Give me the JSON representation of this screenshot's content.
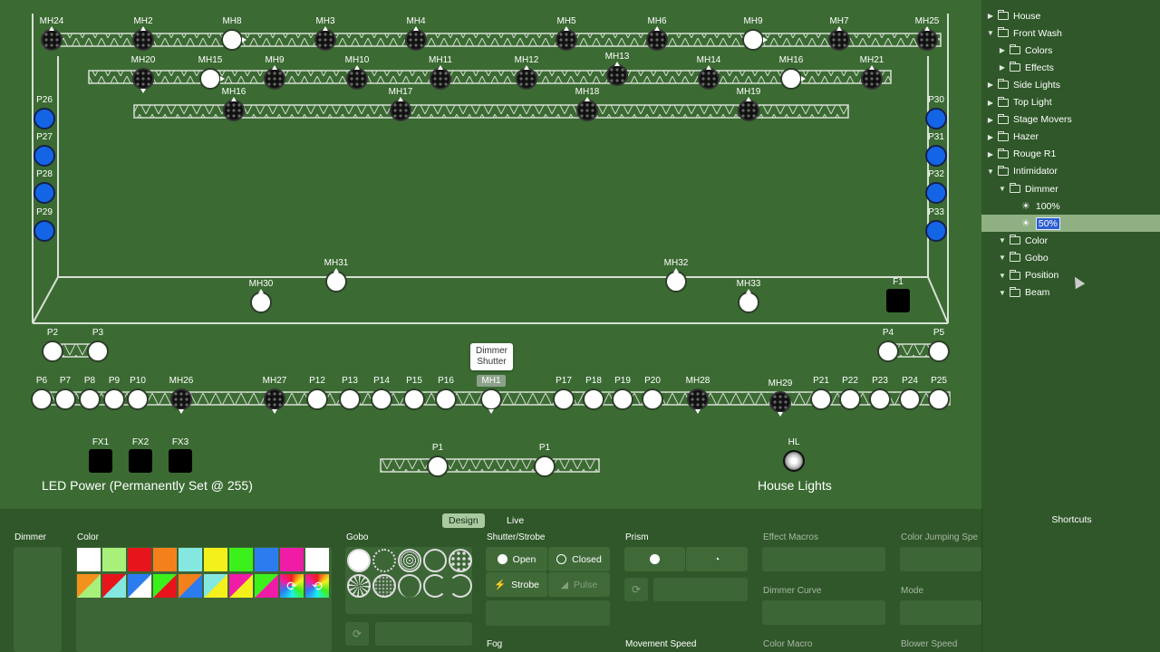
{
  "stage": {
    "fixtures": [
      {
        "id": "MH24",
        "label": "MH24",
        "style": "dark",
        "pointer": "up"
      },
      {
        "id": "MH2",
        "label": "MH2",
        "style": "dark",
        "pointer": "up"
      },
      {
        "id": "MH8",
        "label": "MH8",
        "style": "white",
        "pointer": "right"
      },
      {
        "id": "MH3",
        "label": "MH3",
        "style": "dark",
        "pointer": "up"
      },
      {
        "id": "MH4",
        "label": "MH4",
        "style": "dark",
        "pointer": "up"
      },
      {
        "id": "MH5",
        "label": "MH5",
        "style": "dark",
        "pointer": "up"
      },
      {
        "id": "MH6",
        "label": "MH6",
        "style": "dark",
        "pointer": "up"
      },
      {
        "id": "MH9a",
        "label": "MH9",
        "style": "white",
        "pointer": "right"
      },
      {
        "id": "MH7",
        "label": "MH7",
        "style": "dark",
        "pointer": "up"
      },
      {
        "id": "MH25",
        "label": "MH25",
        "style": "dark",
        "pointer": "up"
      },
      {
        "id": "MH20",
        "label": "MH20",
        "style": "dark",
        "pointer": "down"
      },
      {
        "id": "MH15",
        "label": "MH15",
        "style": "white",
        "pointer": "right"
      },
      {
        "id": "MH9b",
        "label": "MH9",
        "style": "dark",
        "pointer": "up"
      },
      {
        "id": "MH10",
        "label": "MH10",
        "style": "dark",
        "pointer": "up"
      },
      {
        "id": "MH11",
        "label": "MH11",
        "style": "dark",
        "pointer": "up"
      },
      {
        "id": "MH12",
        "label": "MH12",
        "style": "dark",
        "pointer": "up"
      },
      {
        "id": "MH13",
        "label": "MH13",
        "style": "dark",
        "pointer": "up"
      },
      {
        "id": "MH14",
        "label": "MH14",
        "style": "dark",
        "pointer": "up"
      },
      {
        "id": "MH16",
        "label": "MH16",
        "style": "white",
        "pointer": "right"
      },
      {
        "id": "MH21",
        "label": "MH21",
        "style": "dark",
        "pointer": "up"
      },
      {
        "id": "MH16b",
        "label": "MH16",
        "style": "dark",
        "pointer": "up"
      },
      {
        "id": "MH17",
        "label": "MH17",
        "style": "dark",
        "pointer": "up"
      },
      {
        "id": "MH18",
        "label": "MH18",
        "style": "dark",
        "pointer": "up"
      },
      {
        "id": "MH19",
        "label": "MH19",
        "style": "dark",
        "pointer": "up"
      },
      {
        "id": "P26",
        "label": "P26",
        "style": "blue"
      },
      {
        "id": "P27",
        "label": "P27",
        "style": "blue"
      },
      {
        "id": "P28",
        "label": "P28",
        "style": "blue"
      },
      {
        "id": "P29",
        "label": "P29",
        "style": "blue"
      },
      {
        "id": "P30",
        "label": "P30",
        "style": "blue"
      },
      {
        "id": "P31",
        "label": "P31",
        "style": "blue"
      },
      {
        "id": "P32",
        "label": "P32",
        "style": "blue"
      },
      {
        "id": "P33",
        "label": "P33",
        "style": "blue"
      },
      {
        "id": "MH31",
        "label": "MH31",
        "style": "white",
        "pointer": "up"
      },
      {
        "id": "MH32",
        "label": "MH32",
        "style": "white",
        "pointer": "up"
      },
      {
        "id": "MH30",
        "label": "MH30",
        "style": "white",
        "pointer": "up"
      },
      {
        "id": "MH33",
        "label": "MH33",
        "style": "white",
        "pointer": "up"
      },
      {
        "id": "F1",
        "label": "F1",
        "style": "square"
      },
      {
        "id": "P2",
        "label": "P2",
        "style": "white"
      },
      {
        "id": "P3",
        "label": "P3",
        "style": "white"
      },
      {
        "id": "P4",
        "label": "P4",
        "style": "white"
      },
      {
        "id": "P5",
        "label": "P5",
        "style": "white"
      },
      {
        "id": "P6",
        "label": "P6",
        "style": "white"
      },
      {
        "id": "P7",
        "label": "P7",
        "style": "white"
      },
      {
        "id": "P8",
        "label": "P8",
        "style": "white"
      },
      {
        "id": "P9",
        "label": "P9",
        "style": "white"
      },
      {
        "id": "P10",
        "label": "P10",
        "style": "white"
      },
      {
        "id": "MH26",
        "label": "MH26",
        "style": "dark",
        "pointer": "down"
      },
      {
        "id": "MH27",
        "label": "MH27",
        "style": "dark",
        "pointer": "down"
      },
      {
        "id": "P12",
        "label": "P12",
        "style": "white"
      },
      {
        "id": "P13",
        "label": "P13",
        "style": "white"
      },
      {
        "id": "P14",
        "label": "P14",
        "style": "white"
      },
      {
        "id": "P15",
        "label": "P15",
        "style": "white"
      },
      {
        "id": "P16",
        "label": "P16",
        "style": "white"
      },
      {
        "id": "MH1",
        "label": "MH1",
        "style": "white",
        "pointer": "down",
        "selected": true
      },
      {
        "id": "P17",
        "label": "P17",
        "style": "white"
      },
      {
        "id": "P18",
        "label": "P18",
        "style": "white"
      },
      {
        "id": "P19",
        "label": "P19",
        "style": "white"
      },
      {
        "id": "P20",
        "label": "P20",
        "style": "white"
      },
      {
        "id": "MH28",
        "label": "MH28",
        "style": "dark",
        "pointer": "down"
      },
      {
        "id": "MH29",
        "label": "MH29",
        "style": "dark",
        "pointer": "down"
      },
      {
        "id": "P21",
        "label": "P21",
        "style": "white"
      },
      {
        "id": "P22",
        "label": "P22",
        "style": "white"
      },
      {
        "id": "P23",
        "label": "P23",
        "style": "white"
      },
      {
        "id": "P24",
        "label": "P24",
        "style": "white"
      },
      {
        "id": "P25",
        "label": "P25",
        "style": "white"
      },
      {
        "id": "FX1",
        "label": "FX1",
        "style": "square"
      },
      {
        "id": "FX2",
        "label": "FX2",
        "style": "square"
      },
      {
        "id": "FX3",
        "label": "FX3",
        "style": "square"
      },
      {
        "id": "P1a",
        "label": "P1",
        "style": "white"
      },
      {
        "id": "P1b",
        "label": "P1",
        "style": "white"
      },
      {
        "id": "HL",
        "label": "HL",
        "style": "hl"
      }
    ],
    "tooltip": {
      "line1": "Dimmer",
      "line2": "Shutter"
    },
    "led_power_text": "LED Power (Permanently Set @ 255)",
    "house_lights_text": "House Lights"
  },
  "sidebar": {
    "items": [
      {
        "label": "House",
        "expanded": false,
        "level": 0,
        "type": "folder"
      },
      {
        "label": "Front Wash",
        "expanded": true,
        "level": 0,
        "type": "folder"
      },
      {
        "label": "Colors",
        "expanded": false,
        "level": 1,
        "type": "folder"
      },
      {
        "label": "Effects",
        "expanded": false,
        "level": 1,
        "type": "folder"
      },
      {
        "label": "Side Lights",
        "expanded": false,
        "level": 0,
        "type": "folder"
      },
      {
        "label": "Top Light",
        "expanded": false,
        "level": 0,
        "type": "folder"
      },
      {
        "label": "Stage Movers",
        "expanded": false,
        "level": 0,
        "type": "folder"
      },
      {
        "label": "Hazer",
        "expanded": false,
        "level": 0,
        "type": "folder"
      },
      {
        "label": "Rouge R1",
        "expanded": false,
        "level": 0,
        "type": "folder"
      },
      {
        "label": "Intimidator",
        "expanded": true,
        "level": 0,
        "type": "folder"
      },
      {
        "label": "Dimmer",
        "expanded": true,
        "level": 1,
        "type": "folder"
      },
      {
        "label": "100%",
        "level": 2,
        "type": "preset"
      },
      {
        "label": "50%",
        "level": 2,
        "type": "preset",
        "selected": true
      },
      {
        "label": "Color",
        "expanded": true,
        "level": 1,
        "type": "folder"
      },
      {
        "label": "Gobo",
        "expanded": true,
        "level": 1,
        "type": "folder"
      },
      {
        "label": "Position",
        "expanded": true,
        "level": 1,
        "type": "folder"
      },
      {
        "label": "Beam",
        "expanded": true,
        "level": 1,
        "type": "folder"
      }
    ]
  },
  "bottom": {
    "tabs": [
      {
        "label": "Design",
        "active": true
      },
      {
        "label": "Live",
        "active": false
      }
    ],
    "dimmer_title": "Dimmer",
    "color_title": "Color",
    "colors_row1": [
      "#ffffff",
      "#a8f07a",
      "#e8141c",
      "#f4801c",
      "#84e8e0",
      "#f4f01c",
      "#3cf01c",
      "#2c7cf0",
      "#f01ca8",
      "#ffffff"
    ],
    "colors_row2": [
      [
        "#f4901c",
        "#a8f07a"
      ],
      [
        "#e8141c",
        "#84e8e0"
      ],
      [
        "#2c7cf0",
        "#ffffff"
      ],
      [
        "#3cf01c",
        "#e8141c"
      ],
      [
        "#f4801c",
        "#2c7cf0"
      ],
      [
        "#84e8e0",
        "#f4f01c"
      ],
      [
        "#f01ca8",
        "#f4f01c"
      ],
      [
        "#3cf01c",
        "#f01ca8"
      ]
    ],
    "gobo_title": "Gobo",
    "shutter_title": "Shutter/Strobe",
    "shutter_open": "Open",
    "shutter_closed": "Closed",
    "shutter_strobe": "Strobe",
    "shutter_pulse": "Pulse",
    "fog_title": "Fog",
    "prism_title": "Prism",
    "movement_speed_title": "Movement Speed",
    "effect_macros_title": "Effect Macros",
    "dimmer_curve_title": "Dimmer Curve",
    "color_macro_title": "Color Macro",
    "color_jumping_title": "Color Jumping Spe",
    "mode_title": "Mode",
    "blower_speed_title": "Blower Speed",
    "shortcuts_title": "Shortcuts"
  }
}
